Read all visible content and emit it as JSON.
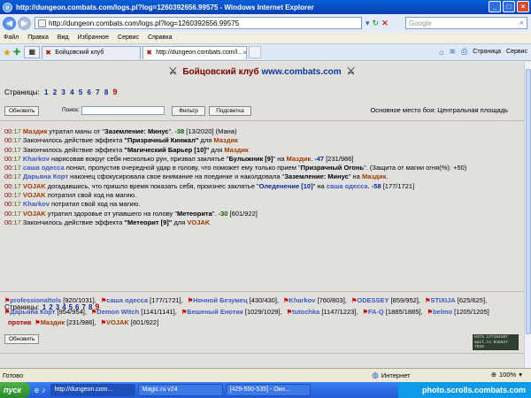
{
  "window": {
    "title": "http://dungeon.combats.com/logs.pl?log=1260392656.99575 - Windows Internet Explorer"
  },
  "address_bar": {
    "url": "http://dungeon.combats.com/logs.pl?log=1260392656.99575",
    "search_placeholder": "Google"
  },
  "menu": {
    "items": [
      "Файл",
      "Правка",
      "Вид",
      "Избранное",
      "Сервис",
      "Справка"
    ]
  },
  "tabs": [
    {
      "label": "Бойцовский клуб",
      "active": false
    },
    {
      "label": "http://dungeon.combats.com/l...",
      "active": true
    }
  ],
  "command_bar": {
    "page_label": "Страница",
    "tools_label": "Сервис"
  },
  "page": {
    "header_prefix": "Бойцовский клуб ",
    "header_site": "www.combats.com",
    "pages_label": "Страницы:",
    "pages": [
      "1",
      "2",
      "3",
      "4",
      "5",
      "6",
      "7",
      "8",
      "9"
    ],
    "current_page": "9",
    "refresh_button": "Обновить",
    "search_label": "Поиск:",
    "search_value": "",
    "filter_button": "Фильтр",
    "highlight_button": "Подсветка",
    "place": "Основное место боя: Центральная площадь",
    "refresh_button_bottom": "Обновить"
  },
  "log": [
    {
      "time": "00:17",
      "segments": [
        {
          "t": "Маздик",
          "c": "p1"
        },
        {
          "t": " утратил маны от \""
        },
        {
          "t": "Заземление: Минус",
          "c": "eff"
        },
        {
          "t": "\". "
        },
        {
          "t": "-38",
          "c": "dmg"
        },
        {
          "t": " [13/2020] (Мана)"
        }
      ]
    },
    {
      "time": "00:17",
      "segments": [
        {
          "t": "Закончилось действие эффекта "
        },
        {
          "t": "\"Призрачный Кинжал\"",
          "c": "eff"
        },
        {
          "t": " для "
        },
        {
          "t": "Маздик",
          "c": "p1"
        }
      ]
    },
    {
      "time": "00:17",
      "segments": [
        {
          "t": "Закончилось действие эффекта "
        },
        {
          "t": "\"Магический Барьер [10]\"",
          "c": "eff"
        },
        {
          "t": " для "
        },
        {
          "t": "Маздик",
          "c": "p1"
        }
      ]
    },
    {
      "time": "00:17",
      "segments": [
        {
          "t": "Kharkov",
          "c": "p2"
        },
        {
          "t": " нарисовав вокруг себя несколько рун, призвал заклятье \""
        },
        {
          "t": "Булыжник [9]",
          "c": "eff"
        },
        {
          "t": "\" на "
        },
        {
          "t": "Маздик",
          "c": "p1"
        },
        {
          "t": ". "
        },
        {
          "t": "-47",
          "c": "dmg-blue"
        },
        {
          "t": " [231/986]"
        }
      ]
    },
    {
      "time": "00:17",
      "wrap": true,
      "segments": [
        {
          "t": "саша одесса",
          "c": "p2"
        },
        {
          "t": " понял, пропустив очередной удар в голову, что поможет ему только прием \""
        },
        {
          "t": "Призрачный Огонь",
          "c": "eff"
        },
        {
          "t": "\". (Защита от магии огня(%): +50)"
        }
      ]
    },
    {
      "time": "00:17",
      "segments": [
        {
          "t": "Дарьяна Корт",
          "c": "p2"
        },
        {
          "t": " наконец сфокусировала свое внимание на поединке и наколдовала \""
        },
        {
          "t": "Заземление: Минус",
          "c": "eff"
        },
        {
          "t": "\" на "
        },
        {
          "t": "Маздик",
          "c": "p1"
        },
        {
          "t": "."
        }
      ]
    },
    {
      "time": "00:17",
      "segments": [
        {
          "t": "VOJAK",
          "c": "p1"
        },
        {
          "t": " догадавшись, что пришло время показать себя, произнес заклятье \""
        },
        {
          "t": "Оледенение [10]",
          "c": "dmg-blue"
        },
        {
          "t": "\" на "
        },
        {
          "t": "саша одесса",
          "c": "p2"
        },
        {
          "t": ". "
        },
        {
          "t": "-58",
          "c": "dmg-blue"
        },
        {
          "t": " [177/1721]"
        }
      ]
    },
    {
      "time": "00:17",
      "segments": [
        {
          "t": "VOJAK",
          "c": "p1"
        },
        {
          "t": " потратил свой ход на магию."
        }
      ]
    },
    {
      "time": "00:17",
      "segments": [
        {
          "t": "Kharkov",
          "c": "p2"
        },
        {
          "t": " потратил свой ход на магию."
        }
      ]
    },
    {
      "time": "00:17",
      "segments": [
        {
          "t": "VOJAK",
          "c": "p1"
        },
        {
          "t": " утратил здоровье от упавшего на голову \""
        },
        {
          "t": "Метеорита",
          "c": "eff"
        },
        {
          "t": "\". "
        },
        {
          "t": "-30",
          "c": "dmg"
        },
        {
          "t": " [601/922]"
        }
      ]
    },
    {
      "time": "00:17",
      "segments": [
        {
          "t": "Закончилось действие эффекта "
        },
        {
          "t": "\"Метеорит [9]\"",
          "c": "eff"
        },
        {
          "t": " для "
        },
        {
          "t": "VOJAK",
          "c": "p1"
        }
      ]
    }
  ],
  "team_blue": [
    {
      "name": "professionaltols",
      "hp": "[920/1031],"
    },
    {
      "name": "саша одесса",
      "hp": "[177/1721],"
    },
    {
      "name": "Ночной Безумец",
      "hp": "[430/430],"
    },
    {
      "name": "Kharkov",
      "hp": "[760/803],"
    },
    {
      "name": "ODESSEY",
      "hp": "[859/952],"
    },
    {
      "name": "STIXIJA",
      "hp": "[625/625],"
    },
    {
      "name": "Дарьяна Корт",
      "hp": "[954/954],"
    },
    {
      "name": "Demon Witch",
      "hp": "[1141/1141],"
    },
    {
      "name": "Бешеный Енотик",
      "hp": "[1029/1029],"
    },
    {
      "name": "tutochka",
      "hp": "[1147/1223],"
    },
    {
      "name": "FA-Q",
      "hp": "[1885/1885],"
    },
    {
      "name": "belmo",
      "hp": "[1205/1205]"
    }
  ],
  "versus": "против",
  "team_red": [
    {
      "name": "Маздик",
      "hp": "[231/986],"
    },
    {
      "name": "VOJAK",
      "hp": "[601/922]"
    }
  ],
  "counter": {
    "line1": "HITS 177194107",
    "line2": "mail.ru 036637",
    "line3": "7626"
  },
  "status_bar": {
    "left": "Готово",
    "zone": "Интернет",
    "zoom": "100%"
  },
  "taskbar": {
    "start": "пуск",
    "tasks": [
      {
        "label": "http://dungeon.com...",
        "active": true
      },
      {
        "label": "Magic.ru v24",
        "active": false
      },
      {
        "label": "[429-550-535] - Окн...",
        "active": false
      }
    ],
    "watermark": "photo.scrolls.combats.com"
  }
}
